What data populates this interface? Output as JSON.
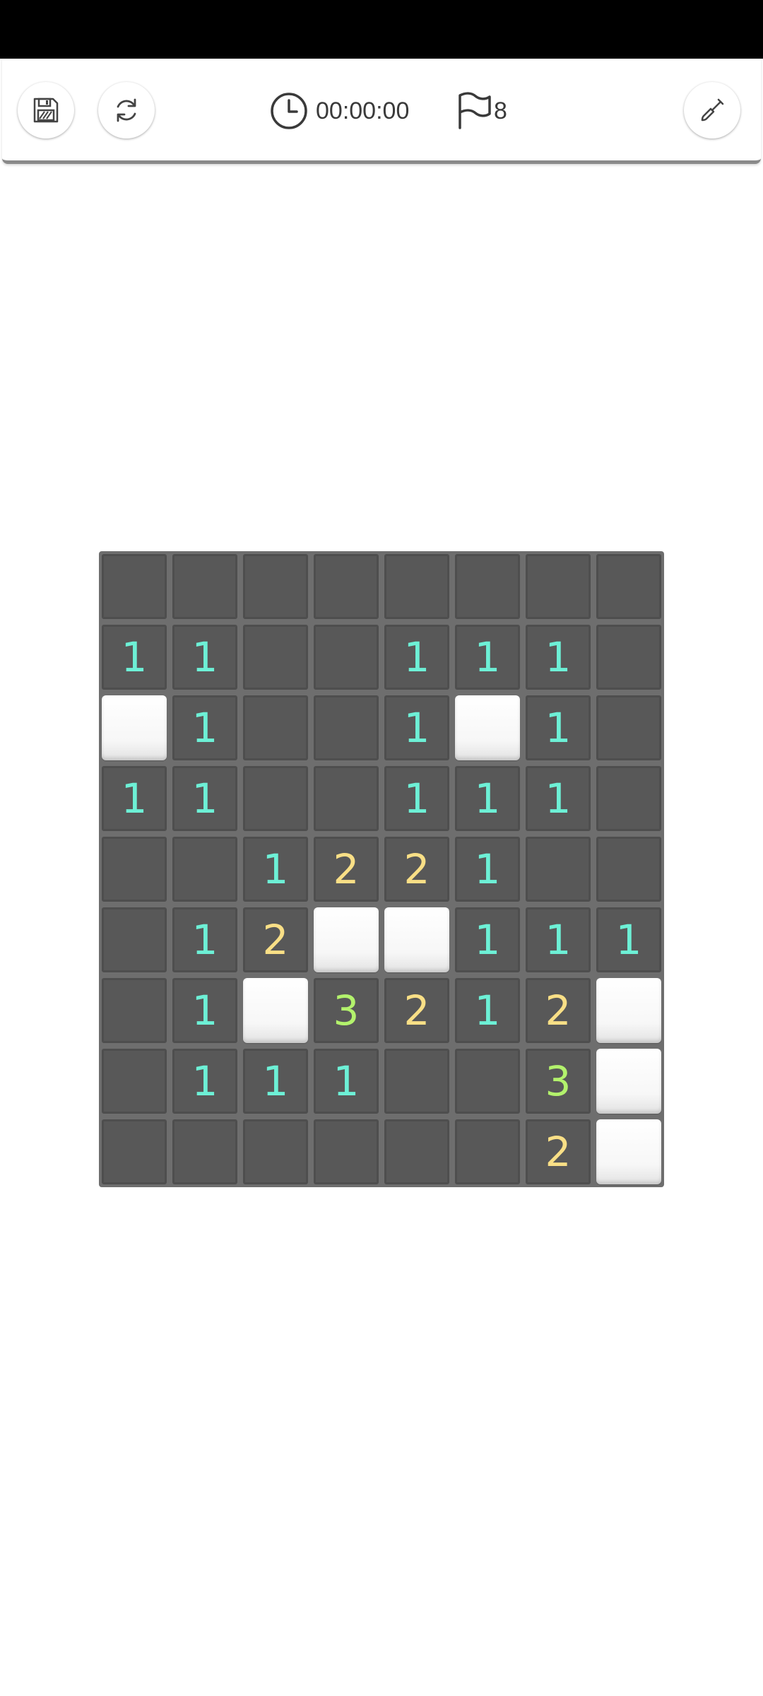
{
  "toolbar": {
    "save_icon": "floppy-disk-icon",
    "restart_icon": "refresh-icon",
    "timer_icon": "clock-icon",
    "timer": "00:00:00",
    "flag_icon": "flag-icon",
    "flags_remaining": "8",
    "dig_icon": "shovel-icon"
  },
  "colors": {
    "one": "#6df0d6",
    "two": "#f9df86",
    "three": "#b3f26c",
    "revealed": "#585858",
    "board": "#6e6e6e"
  },
  "board": {
    "columns": 8,
    "rows": [
      [
        "",
        "",
        "",
        "",
        "",
        "",
        "",
        ""
      ],
      [
        "1",
        "1",
        "",
        "",
        "1",
        "1",
        "1",
        ""
      ],
      [
        "#",
        "1",
        "",
        "",
        "1",
        "#",
        "1",
        ""
      ],
      [
        "1",
        "1",
        "",
        "",
        "1",
        "1",
        "1",
        ""
      ],
      [
        "",
        "",
        "1",
        "2",
        "2",
        "1",
        "",
        ""
      ],
      [
        "",
        "1",
        "2",
        "#",
        "#",
        "1",
        "1",
        "1"
      ],
      [
        "",
        "1",
        "#",
        "3",
        "2",
        "1",
        "2",
        "#"
      ],
      [
        "",
        "1",
        "1",
        "1",
        "",
        "",
        "3",
        "#"
      ],
      [
        "",
        "",
        "",
        "",
        "",
        "",
        "2",
        "#"
      ]
    ]
  }
}
